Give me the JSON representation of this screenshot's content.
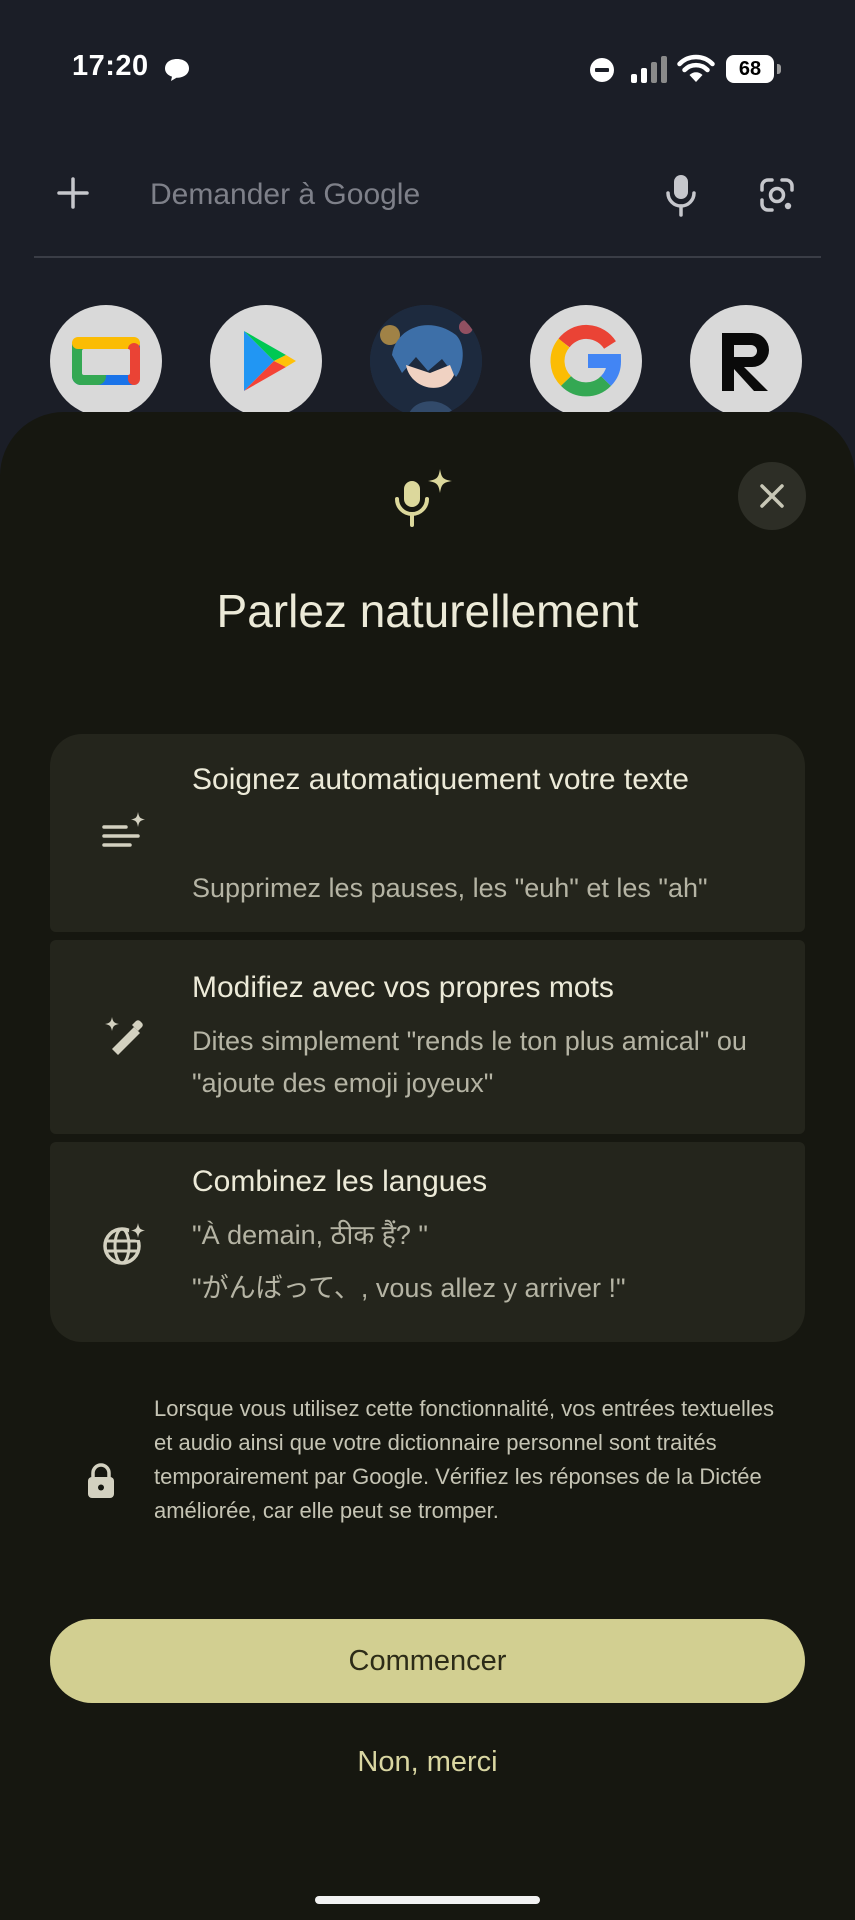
{
  "status_bar": {
    "time": "17:20",
    "battery": "68",
    "icons": [
      "chat-bubble-icon",
      "do-not-disturb-icon",
      "signal-icon",
      "wifi-icon",
      "battery-icon"
    ]
  },
  "search": {
    "placeholder": "Demander à Google",
    "icons": [
      "plus-icon",
      "mic-icon",
      "lens-icon"
    ]
  },
  "apps": [
    {
      "name": "google-tv-icon"
    },
    {
      "name": "play-store-icon"
    },
    {
      "name": "anime-avatar-icon"
    },
    {
      "name": "google-icon"
    },
    {
      "name": "revolut-icon",
      "letter": "R"
    }
  ],
  "sheet": {
    "title": "Parlez naturellement",
    "features": [
      {
        "icon": "text-sparkle-icon",
        "title": "Soignez automatiquement votre texte",
        "description": "Supprimez les pauses, les \"euh\" et les \"ah\""
      },
      {
        "icon": "magic-pen-icon",
        "title": "Modifiez avec vos propres mots",
        "description": "Dites simplement \"rends le ton plus amical\" ou \"ajoute des emoji joyeux\""
      },
      {
        "icon": "globe-sparkle-icon",
        "title": "Combinez les langues",
        "description_line1": "\"À demain, ठीक हैं?  \"",
        "description_line2": "\"がんばって、, vous allez y arriver !\""
      }
    ],
    "privacy_text": "Lorsque vous utilisez cette fonctionnalité, vos entrées textuelles et audio ainsi que votre dictionnaire personnel sont traités temporairement par Google. Vérifiez les réponses de la Dictée améliorée, car elle peut se tromper.",
    "primary_button": "Commencer",
    "secondary_button": "Non, merci"
  },
  "colors": {
    "sheet_background": "#161710",
    "card_background": "#24251c",
    "accent": "#d2cf91",
    "accent_text": "#d9d6a2"
  }
}
